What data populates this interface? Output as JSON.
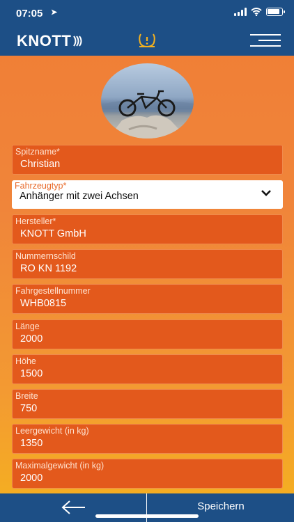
{
  "status_bar": {
    "time": "07:05"
  },
  "header": {
    "brand": "KNOTT"
  },
  "fields": [
    {
      "label": "Spitzname*",
      "value": "Christian"
    },
    {
      "label": "Hersteller*",
      "value": "KNOTT GmbH"
    },
    {
      "label": "Nummernschild",
      "value": "RO KN 1192"
    },
    {
      "label": "Fahrgestellnummer",
      "value": "WHB0815"
    },
    {
      "label": "Länge",
      "value": "2000"
    },
    {
      "label": "Höhe",
      "value": "1500"
    },
    {
      "label": "Breite",
      "value": "750"
    },
    {
      "label": "Leergewicht (in kg)",
      "value": "1350"
    },
    {
      "label": "Maximalgewicht (in kg)",
      "value": "2000"
    }
  ],
  "vehicle_type": {
    "label": "Fahrzeugtyp*",
    "value": "Anhänger mit zwei Achsen"
  },
  "footer": {
    "save_label": "Speichern"
  },
  "colors": {
    "header_bg": "#1d4f86",
    "field_bg": "#e3591c",
    "accent_icon": "#f5b21e"
  }
}
